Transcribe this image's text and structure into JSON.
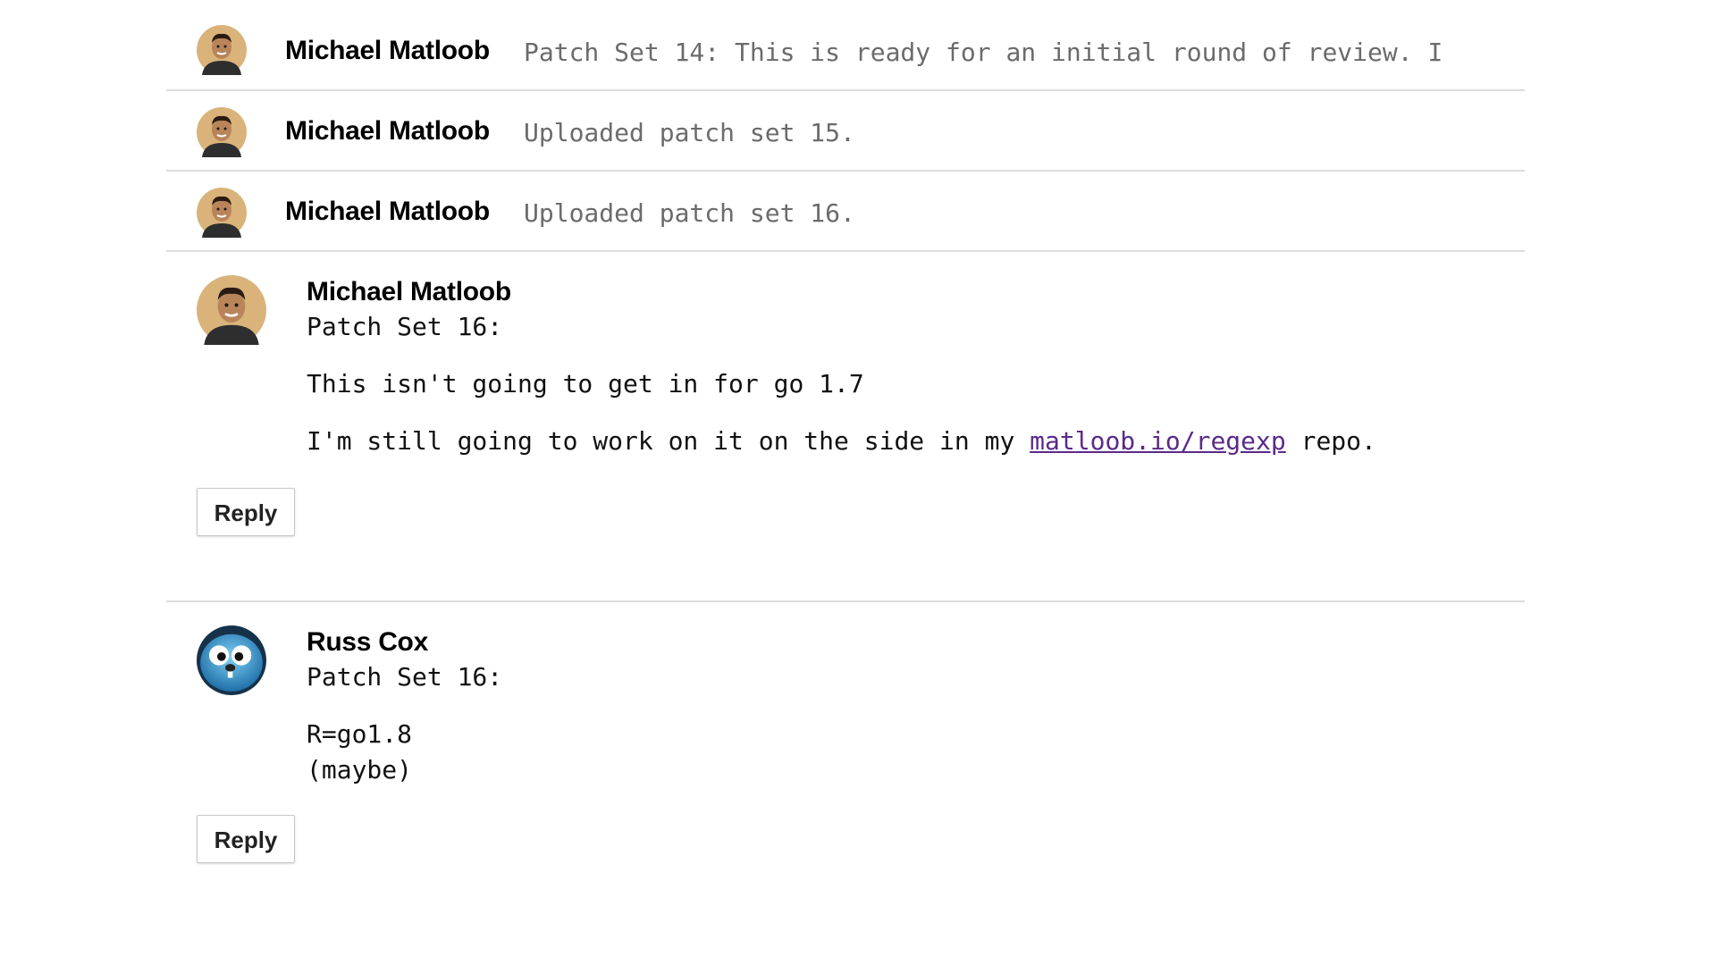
{
  "messages_collapsed": [
    {
      "author": "Michael Matloob",
      "summary": "Patch Set 14: This is ready for an initial round of review. I"
    },
    {
      "author": "Michael Matloob",
      "summary": "Uploaded patch set 15."
    },
    {
      "author": "Michael Matloob",
      "summary": "Uploaded patch set 16."
    }
  ],
  "message_matloob": {
    "author": "Michael Matloob",
    "line1": "Patch Set 16:",
    "line2": "This isn't going to get in for go 1.7",
    "line3_before": "I'm still going to work on it on the side in my ",
    "link_text": "matloob.io/regexp",
    "line3_after": " repo.",
    "reply_label": "Reply"
  },
  "message_cox": {
    "author": "Russ Cox",
    "line1": "Patch Set 16:",
    "line2": "R=go1.8",
    "line3": "(maybe)",
    "reply_label": "Reply"
  },
  "colors": {
    "divider": "#dddddd",
    "summary_text": "#6b6b6b",
    "link": "#5a2a8a"
  },
  "icons": {
    "matloob_avatar": "person-photo-avatar",
    "cox_avatar": "gopher-avatar"
  }
}
